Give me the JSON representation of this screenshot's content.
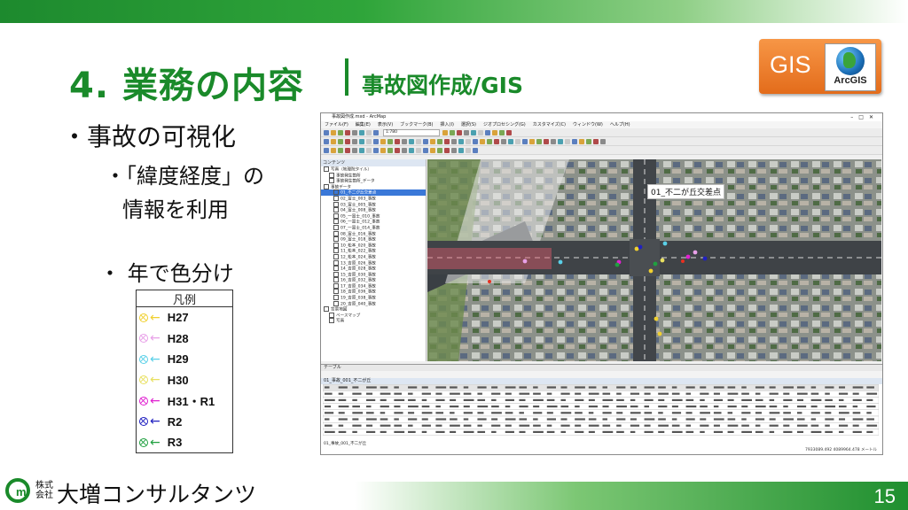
{
  "slide": {
    "title": "4. 業務の内容",
    "subtitle": "事故図作成/GIS",
    "page_number": "15",
    "badge_text": "GIS",
    "badge_logo_text": "ArcGIS"
  },
  "bullets": {
    "main": "・事故の可視化",
    "sub1_line1": "・「緯度経度」の",
    "sub1_line2": "情報を利用",
    "sub2": "・ 年で色分け"
  },
  "legend": {
    "title": "凡例",
    "items": [
      {
        "label": "H27",
        "color": "#f0d030"
      },
      {
        "label": "H28",
        "color": "#e8a0e8"
      },
      {
        "label": "H29",
        "color": "#5ad0e8"
      },
      {
        "label": "H30",
        "color": "#e8e060"
      },
      {
        "label": "H31・R1",
        "color": "#e020d0"
      },
      {
        "label": "R2",
        "color": "#2020c0"
      },
      {
        "label": "R3",
        "color": "#20a040"
      }
    ]
  },
  "app": {
    "window_title": "事故図作成.mxd - ArcMap",
    "menus": [
      "ファイル(F)",
      "編集(E)",
      "表示(V)",
      "ブックマーク(B)",
      "挿入(I)",
      "選択(S)",
      "ジオプロセシング(G)",
      "カスタマイズ(C)",
      "ウィンドウ(W)",
      "ヘルプ(H)"
    ],
    "scale_value": "1:780",
    "toc_title": "コンテンツ",
    "toc_items": [
      "写真（地理院タイル）",
      "事故発生箇所",
      "事故発生箇所_データ",
      "事故データ",
      "01_不二が丘交差点",
      "02_富士_003_事故",
      "03_富士_005_事故",
      "04_富士_008_事故",
      "05_一富士_010_事故",
      "06_一富士_012_事故",
      "07_一富士_014_事故",
      "08_富士_016_事故",
      "09_富士_018_事故",
      "10_松本_020_事故",
      "11_松本_022_事故",
      "12_松本_024_事故",
      "13_吉原_026_事故",
      "14_吉原_028_事故",
      "15_吉原_030_事故",
      "16_吉原_032_事故",
      "17_吉原_034_事故",
      "18_吉原_036_事故",
      "19_吉原_038_事故",
      "20_吉原_040_事故",
      "背景地図",
      "ベースマップ",
      "写真"
    ],
    "map_label": "01_不二が丘交差点",
    "attr_title": "テーブル",
    "attr_tab": "01_事故_001_不二が丘",
    "attr_footer": "01_事故_001_不二が丘",
    "status_text": "7933089.492 4089964.478 メートル"
  }
}
